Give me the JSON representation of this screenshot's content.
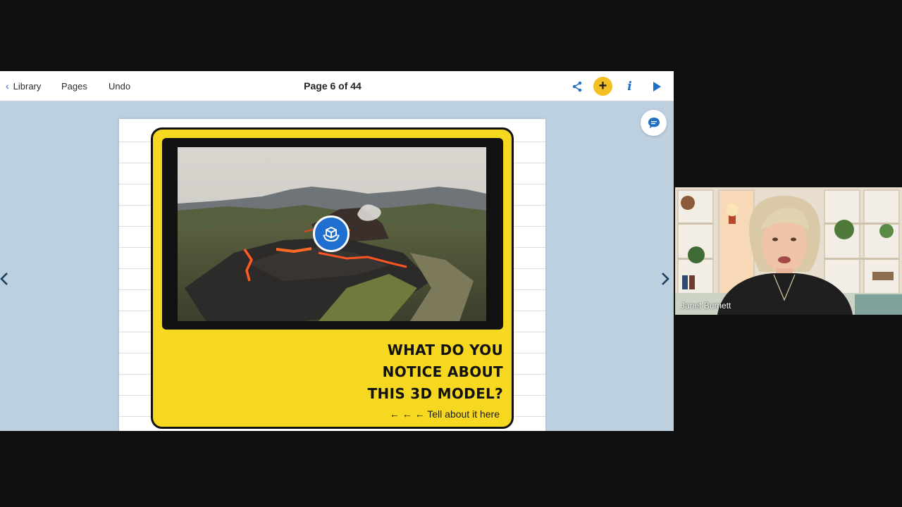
{
  "toolbar": {
    "library_label": "Library",
    "pages_label": "Pages",
    "undo_label": "Undo",
    "page_indicator": "Page 6 of 44",
    "add_symbol": "+",
    "info_symbol": "i"
  },
  "icons": {
    "back": "chevron-left-icon",
    "share": "share-icon",
    "add": "plus-icon",
    "info": "info-icon",
    "play": "play-icon",
    "comment": "comment-icon",
    "prev": "chevron-left-icon",
    "next": "chevron-right-icon",
    "model": "3d-model-icon"
  },
  "colors": {
    "accent": "#1f6fc5",
    "add_button": "#f4bf22",
    "canvas": "#bdd0e0",
    "card": "#f6d821"
  },
  "card": {
    "heading_lines": [
      "What do you",
      "notice about",
      "this 3D model?"
    ],
    "hint": "← ← ← Tell about it here"
  },
  "video": {
    "participant_name": "Janet Burnett"
  }
}
